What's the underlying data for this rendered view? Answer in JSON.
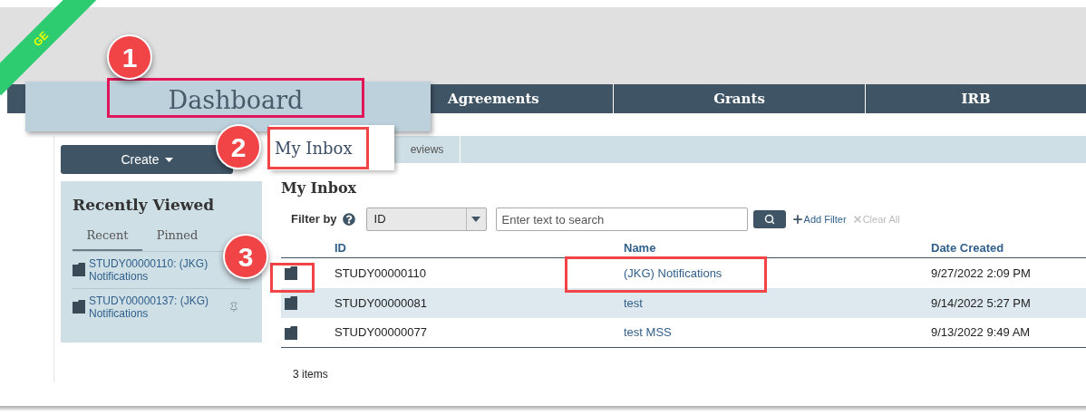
{
  "ribbon": {
    "label": "GE"
  },
  "nav": [
    {
      "label": "Agreements"
    },
    {
      "label": "Grants"
    },
    {
      "label": "IRB"
    }
  ],
  "dashboard_callout": {
    "label": "Dashboard"
  },
  "create_button": {
    "label": "Create"
  },
  "recently_viewed": {
    "title": "Recently Viewed",
    "tabs": [
      {
        "label": "Recent",
        "selected": true
      },
      {
        "label": "Pinned",
        "selected": false
      }
    ],
    "items": [
      {
        "label": "STUDY00000110: (JKG) Notifications",
        "pinned": false
      },
      {
        "label": "STUDY00000137: (JKG) Notifications",
        "pinned": true
      }
    ]
  },
  "tabs": [
    {
      "label": "My Inbox",
      "selected": true
    },
    {
      "label": "eviews",
      "selected": false
    }
  ],
  "inbox": {
    "title": "My Inbox",
    "filter_label": "Filter by",
    "filter_field": "ID",
    "search": {
      "placeholder": "Enter text to search"
    },
    "add_filter": "Add Filter",
    "clear_all": "Clear All",
    "columns": [
      "ID",
      "Name",
      "Date Created"
    ],
    "rows": [
      {
        "id": "STUDY00000110",
        "name": "(JKG) Notifications",
        "date": "9/27/2022 2:09 PM",
        "highlighted": false
      },
      {
        "id": "STUDY00000081",
        "name": "test",
        "date": "9/14/2022 5:27 PM",
        "highlighted": true
      },
      {
        "id": "STUDY00000077",
        "name": "test MSS",
        "date": "9/13/2022 9:49 AM",
        "highlighted": false
      }
    ],
    "count": "3 items"
  },
  "callouts": [
    {
      "number": "1"
    },
    {
      "number": "2"
    },
    {
      "number": "3"
    }
  ]
}
